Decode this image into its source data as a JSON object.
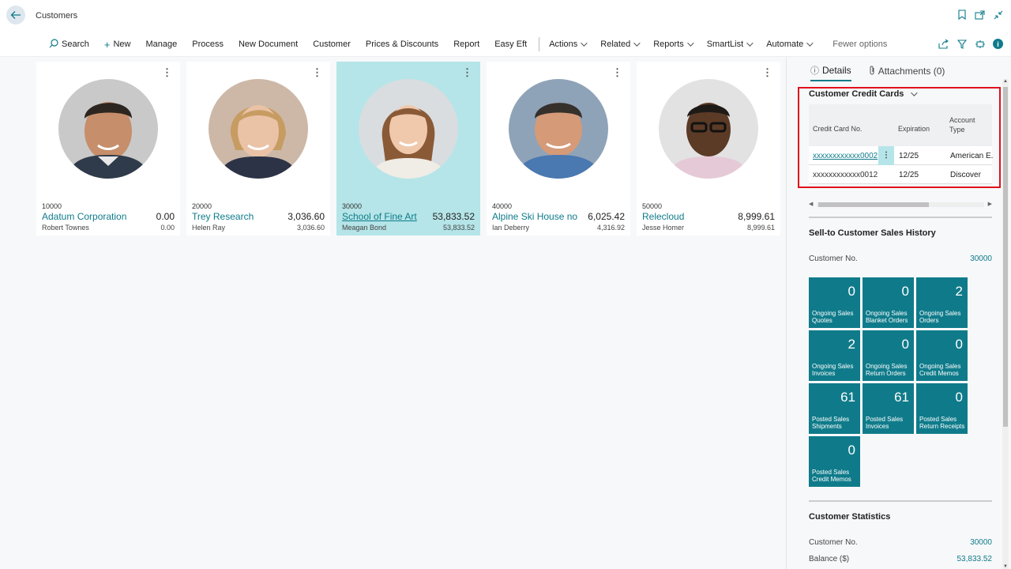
{
  "header": {
    "title": "Customers"
  },
  "toolbar": {
    "search": "Search",
    "new": "New",
    "manage": "Manage",
    "process": "Process",
    "new_document": "New Document",
    "customer": "Customer",
    "prices_discounts": "Prices & Discounts",
    "report": "Report",
    "easy_eft": "Easy Eft",
    "actions": "Actions",
    "related": "Related",
    "reports": "Reports",
    "smartlist": "SmartList",
    "automate": "Automate",
    "fewer_options": "Fewer options"
  },
  "customers": [
    {
      "no": "10000",
      "name": "Adatum Corporation",
      "balance": "0.00",
      "contact": "Robert Townes",
      "balance2": "0.00"
    },
    {
      "no": "20000",
      "name": "Trey Research",
      "balance": "3,036.60",
      "contact": "Helen Ray",
      "balance2": "3,036.60"
    },
    {
      "no": "30000",
      "name": "School of Fine Art",
      "balance": "53,833.52",
      "contact": "Meagan Bond",
      "balance2": "53,833.52"
    },
    {
      "no": "40000",
      "name": "Alpine Ski House no ...",
      "balance": "6,025.42",
      "contact": "Ian Deberry",
      "balance2": "4,316.92"
    },
    {
      "no": "50000",
      "name": "Relecloud",
      "balance": "8,999.61",
      "contact": "Jesse Homer",
      "balance2": "8,999.61"
    }
  ],
  "panel": {
    "tab_details": "Details",
    "tab_attachments": "Attachments (0)",
    "credit_cards": {
      "title": "Customer Credit Cards",
      "col_card": "Credit Card No.",
      "col_exp": "Expiration",
      "col_type": "Account Type",
      "rows": [
        {
          "card": "xxxxxxxxxxxx0002",
          "exp": "12/25",
          "type": "American E."
        },
        {
          "card": "xxxxxxxxxxxx0012",
          "exp": "12/25",
          "type": "Discover"
        }
      ]
    },
    "sales_history": {
      "title": "Sell-to Customer Sales History",
      "customer_no_label": "Customer No.",
      "customer_no": "30000",
      "cues": [
        {
          "num": "0",
          "label": "Ongoing Sales Quotes"
        },
        {
          "num": "0",
          "label": "Ongoing Sales Blanket Orders"
        },
        {
          "num": "2",
          "label": "Ongoing Sales Orders"
        },
        {
          "num": "2",
          "label": "Ongoing Sales Invoices"
        },
        {
          "num": "0",
          "label": "Ongoing Sales Return Orders"
        },
        {
          "num": "0",
          "label": "Ongoing Sales Credit Memos"
        },
        {
          "num": "61",
          "label": "Posted Sales Shipments"
        },
        {
          "num": "61",
          "label": "Posted Sales Invoices"
        },
        {
          "num": "0",
          "label": "Posted Sales Return Receipts"
        },
        {
          "num": "0",
          "label": "Posted Sales Credit Memos"
        }
      ]
    },
    "statistics": {
      "title": "Customer Statistics",
      "customer_no_label": "Customer No.",
      "customer_no": "30000",
      "balance_label": "Balance ($)",
      "balance": "53,833.52"
    }
  },
  "colors": {
    "accent": "#0f7b8a",
    "selected": "#b5e5e8",
    "highlight_border": "#e0111a"
  }
}
